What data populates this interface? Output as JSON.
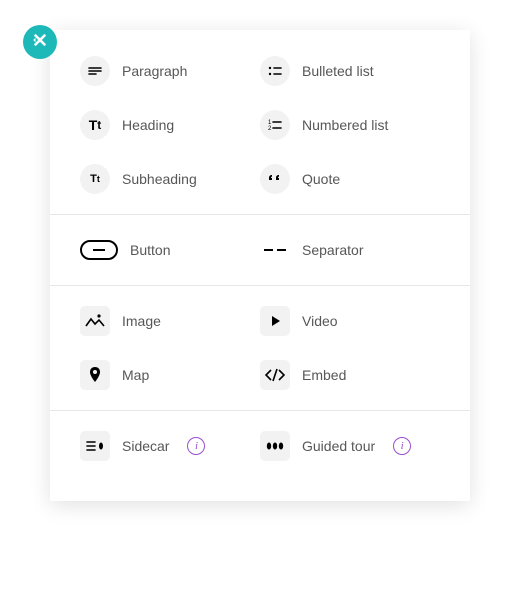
{
  "close": "×",
  "groups": [
    {
      "rows": [
        {
          "left": {
            "id": "paragraph",
            "label": "Paragraph",
            "icon": "paragraph"
          },
          "right": {
            "id": "bulleted-list",
            "label": "Bulleted list",
            "icon": "bulleted-list"
          }
        },
        {
          "left": {
            "id": "heading",
            "label": "Heading",
            "icon": "heading"
          },
          "right": {
            "id": "numbered-list",
            "label": "Numbered list",
            "icon": "numbered-list"
          }
        },
        {
          "left": {
            "id": "subheading",
            "label": "Subheading",
            "icon": "subheading"
          },
          "right": {
            "id": "quote",
            "label": "Quote",
            "icon": "quote"
          }
        }
      ]
    },
    {
      "rows": [
        {
          "left": {
            "id": "button",
            "label": "Button",
            "icon": "button"
          },
          "right": {
            "id": "separator",
            "label": "Separator",
            "icon": "separator"
          }
        }
      ]
    },
    {
      "rows": [
        {
          "left": {
            "id": "image",
            "label": "Image",
            "icon": "image"
          },
          "right": {
            "id": "video",
            "label": "Video",
            "icon": "video"
          }
        },
        {
          "left": {
            "id": "map",
            "label": "Map",
            "icon": "map"
          },
          "right": {
            "id": "embed",
            "label": "Embed",
            "icon": "embed"
          }
        }
      ]
    },
    {
      "rows": [
        {
          "left": {
            "id": "sidecar",
            "label": "Sidecar",
            "icon": "sidecar",
            "info": true
          },
          "right": {
            "id": "guided-tour",
            "label": "Guided tour",
            "icon": "guided-tour",
            "info": true
          }
        }
      ]
    }
  ]
}
